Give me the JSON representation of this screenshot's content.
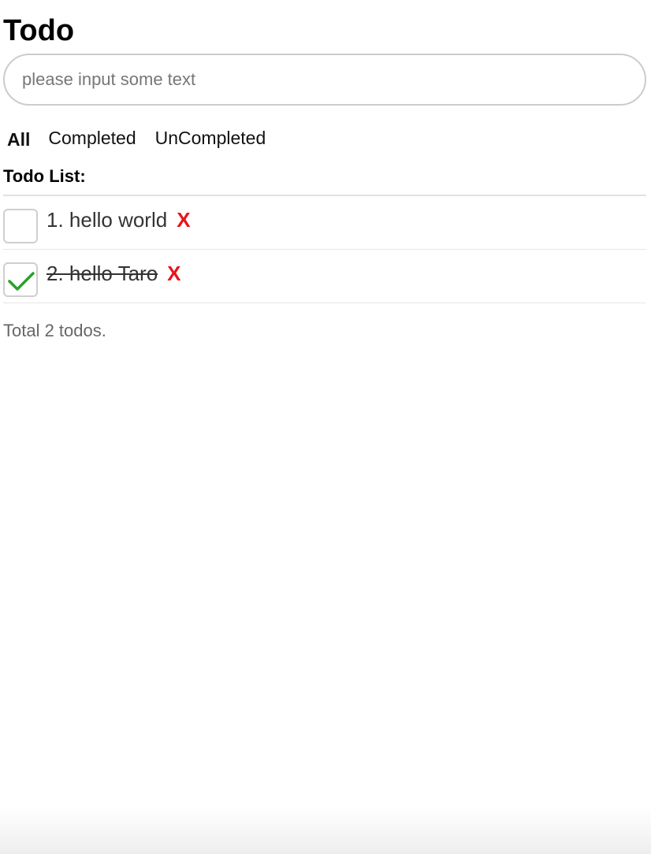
{
  "app": {
    "title": "Todo"
  },
  "input": {
    "placeholder": "please input some text",
    "value": ""
  },
  "filters": [
    {
      "label": "All",
      "active": true
    },
    {
      "label": "Completed",
      "active": false
    },
    {
      "label": "UnCompleted",
      "active": false
    }
  ],
  "list": {
    "heading": "Todo List:",
    "items": [
      {
        "text": "1. hello world",
        "completed": false,
        "delete_label": "X"
      },
      {
        "text": "2. hello Taro",
        "completed": true,
        "delete_label": "X"
      }
    ]
  },
  "footer": {
    "total_text": "Total 2 todos."
  },
  "colors": {
    "delete": "#e8141c",
    "check": "#2aa02a",
    "border": "#cccccc",
    "muted_text": "#666666"
  },
  "icons": {
    "checked": "checkmark-icon"
  }
}
